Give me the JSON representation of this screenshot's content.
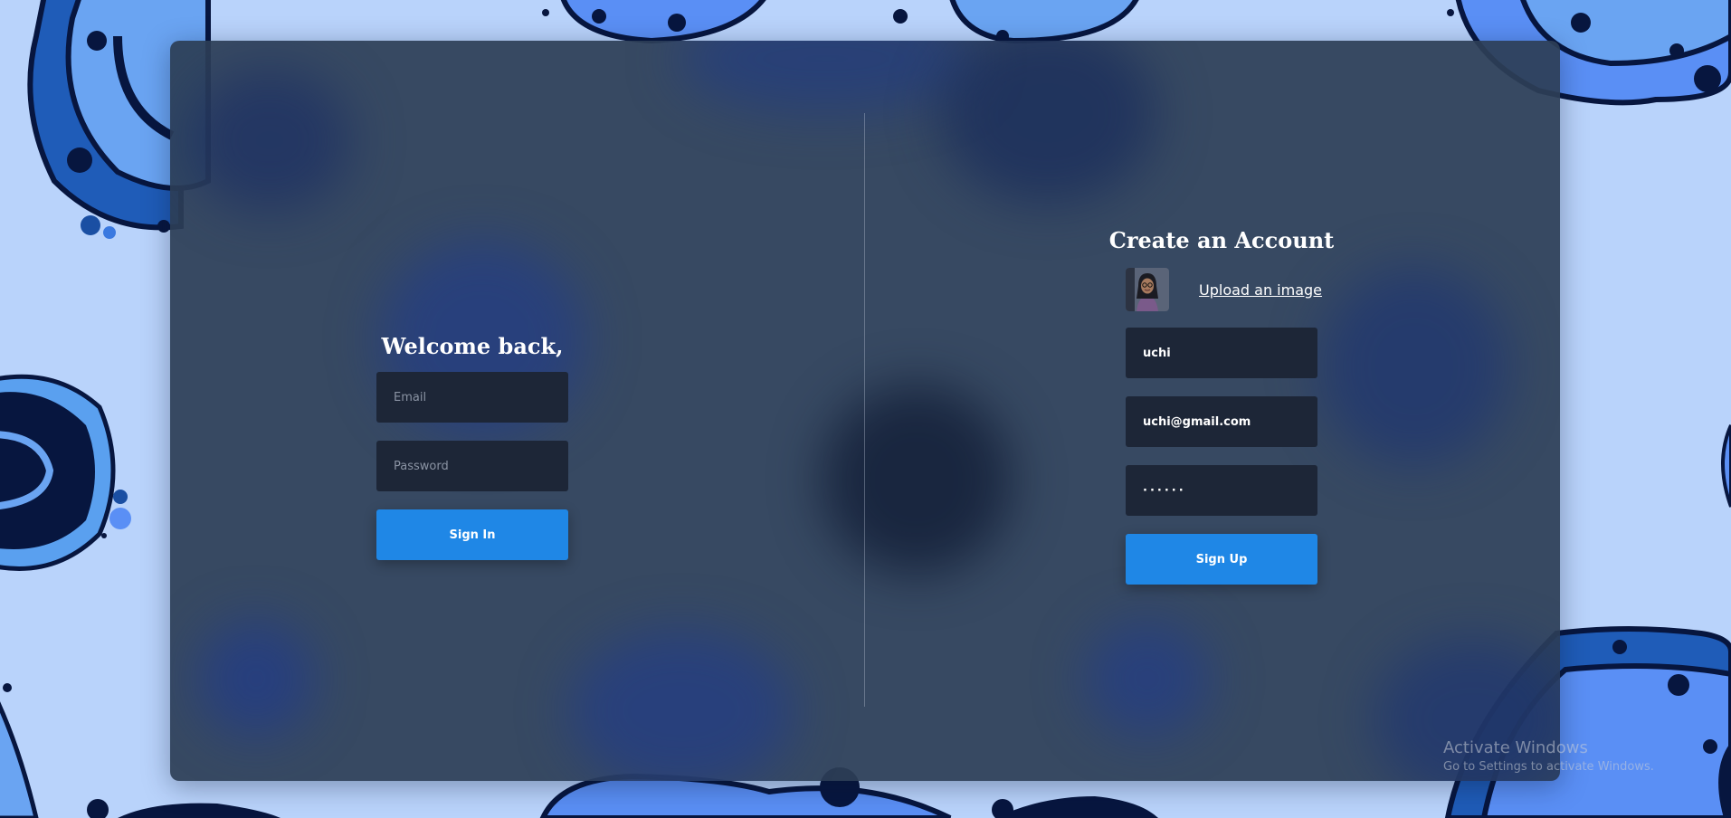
{
  "signin": {
    "title": "Welcome back,",
    "email_placeholder": "Email",
    "password_placeholder": "Password",
    "button_label": "Sign In"
  },
  "signup": {
    "title": "Create an Account",
    "upload_label": "Upload an image",
    "name_value": "uchi",
    "email_value": "uchi@gmail.com",
    "password_value": "······",
    "button_label": "Sign Up"
  },
  "watermark": {
    "title": "Activate Windows",
    "subtitle": "Go to Settings to activate Windows."
  },
  "colors": {
    "page_background": "#b9d3fb",
    "card_background": "#2d3e56",
    "input_background": "#1d2637",
    "button_primary": "#1f87e6",
    "blob_dark": "#0b2a6e",
    "blob_light": "#5a8ff5"
  },
  "icons": {
    "avatar": "profile-photo"
  }
}
